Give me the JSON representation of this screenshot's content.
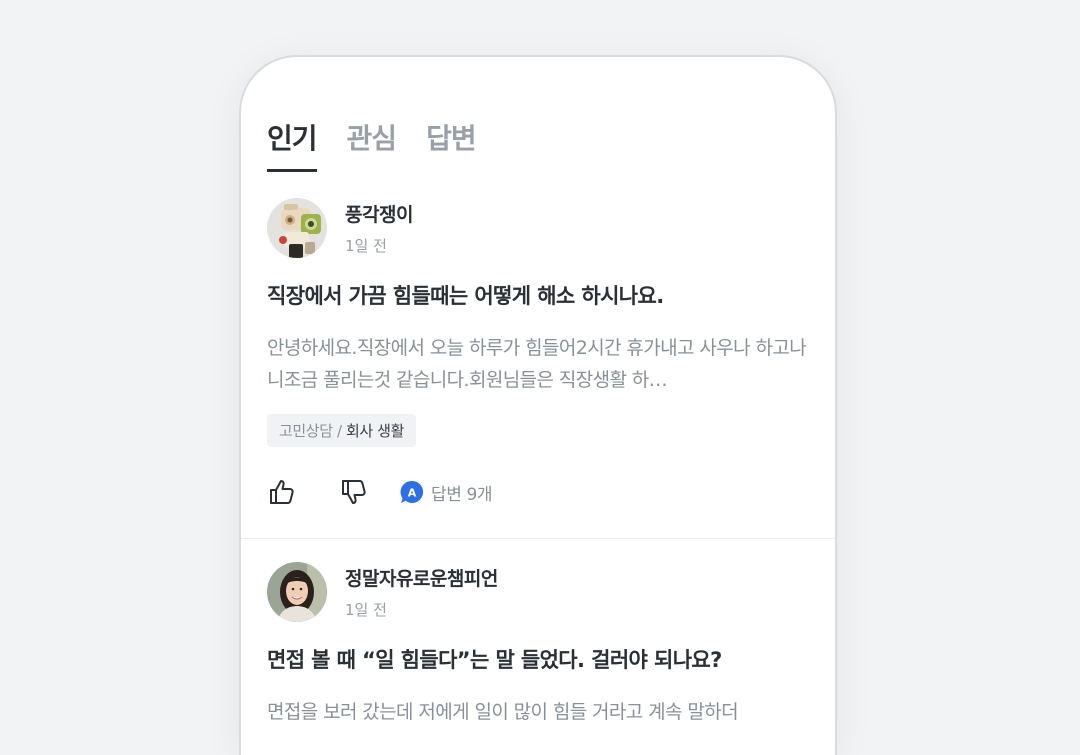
{
  "tabs": [
    {
      "label": "인기",
      "active": true
    },
    {
      "label": "관심",
      "active": false
    },
    {
      "label": "답변",
      "active": false
    }
  ],
  "posts": [
    {
      "author": "풍각쟁이",
      "time": "1일 전",
      "title": "직장에서 가끔 힘들때는 어떻게 해소 하시나요.",
      "body": "안녕하세요.직장에서 오늘 하루가 힘들어2시간 휴가내고 사우나 하고나니조금 풀리는것 같습니다.회원님들은 직장생활 하…",
      "tag_category": "고민상담",
      "tag_separator": " / ",
      "tag_sub": "회사 생활",
      "answer_label": "답변 9개",
      "avatar_icon": "robot-toy-avatar",
      "answer_badge": "A"
    },
    {
      "author": "정말자유로운챔피언",
      "time": "1일 전",
      "title": "면접 볼 때 “일 힘들다”는 말 들었다. 걸러야 되나요?",
      "body": "면접을 보러 갔는데 저에게 일이 많이 힘들 거라고 계속 말하더",
      "avatar_icon": "woman-portrait-avatar"
    }
  ],
  "colors": {
    "accent_blue": "#2f6fe4",
    "text_dark": "#2b2f36",
    "text_muted": "#8a9099",
    "tag_bg": "#f1f2f4"
  }
}
